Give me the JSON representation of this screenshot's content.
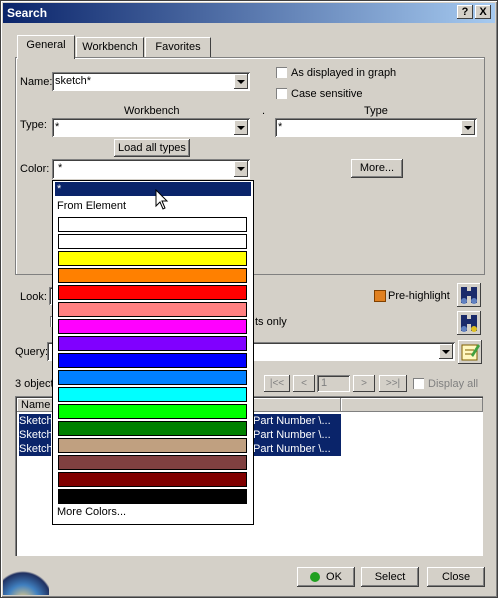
{
  "window": {
    "title": "Search",
    "help_label": "?",
    "close_label": "X"
  },
  "tabs": [
    {
      "label": "General"
    },
    {
      "label": "Workbench"
    },
    {
      "label": "Favorites"
    }
  ],
  "general": {
    "name_label": "Name:",
    "name_value": "sketch*",
    "as_displayed_label": "As displayed in graph",
    "case_sensitive_label": "Case sensitive",
    "workbench_header": "Workbench",
    "type_header": "Type",
    "type_label": "Type:",
    "type_value": "*",
    "type_right_value": "*",
    "load_all_types_label": "Load all types",
    "color_label": "Color:",
    "color_value": "*",
    "more_label": "More...",
    "dot_label": "."
  },
  "dropdown": {
    "selected": "*",
    "from_element": "From Element",
    "more_colors": "More Colors...",
    "swatches": [
      "#ffffff",
      "#ffffff",
      "#ffff00",
      "#ff8000",
      "#ff0000",
      "#ff8080",
      "#ff00ff",
      "#8000ff",
      "#0000ff",
      "#0080ff",
      "#00ffff",
      "#00ff00",
      "#008000",
      "#c0a080",
      "#804040",
      "#800000",
      "#000000"
    ]
  },
  "look": {
    "label": "Look:",
    "pre_highlight_label": "Pre-highlight",
    "partial_text": "ts only"
  },
  "query": {
    "label": "Query:"
  },
  "results": {
    "count_text": "3 object",
    "nav": [
      "|<<",
      "<",
      "1",
      ">",
      ">>|"
    ],
    "display_all_label": "Display all",
    "col_name": "Name",
    "rows": [
      {
        "name": "Sketch",
        "path": "Part Number \\..."
      },
      {
        "name": "Sketch",
        "path": "Part Number \\..."
      },
      {
        "name": "Sketch",
        "path": "Part Number \\..."
      }
    ]
  },
  "buttons": {
    "ok_label": "OK",
    "select_label": "Select",
    "close_label": "Close"
  },
  "colors": {
    "title_start": "#0a246a",
    "title_end": "#a6caf0",
    "selection": "#0a246a",
    "face": "#d4d0c8"
  }
}
